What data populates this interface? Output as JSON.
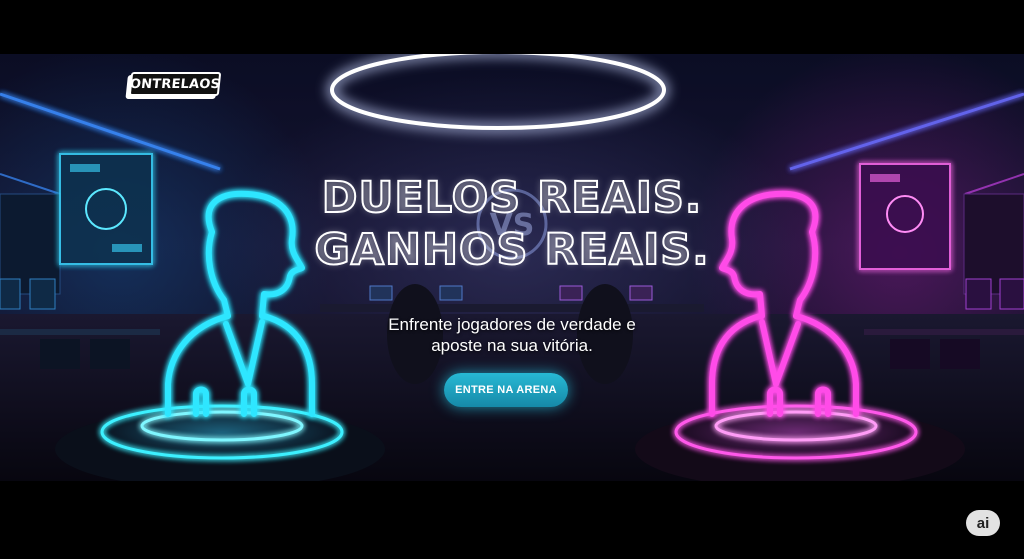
{
  "brand": {
    "logo_text": "ONTRELAOS"
  },
  "hero": {
    "headline_line1": "DUELOS REAIS.",
    "headline_line2": "GANHOS REAIS.",
    "subtitle_line1": "Enfrente jogadores de verdade e",
    "subtitle_line2": "aposte na sua vitória.",
    "cta_label": "ENTRE NA ARENA"
  },
  "badge": {
    "label": "ai"
  },
  "colors": {
    "cyan_neon": "#2fe6ff",
    "magenta_neon": "#ff4ce8",
    "button": "#1fa3c2",
    "background": "#0d0b1c"
  },
  "icons": [
    "player-left-silhouette-icon",
    "player-right-silhouette-icon",
    "ceiling-ring-light-icon",
    "versus-emblem-icon"
  ]
}
